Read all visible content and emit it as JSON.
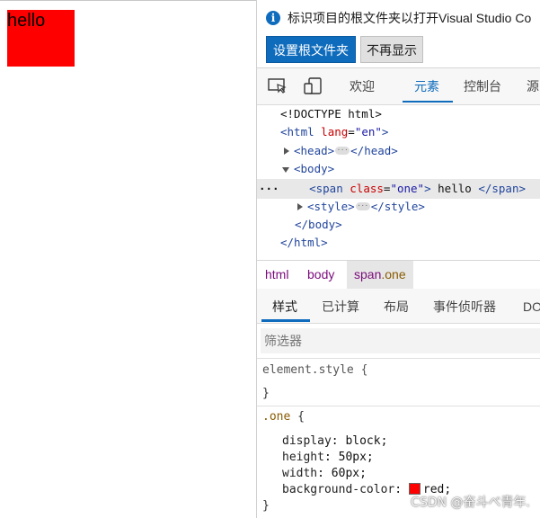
{
  "preview": {
    "hello_text": "hello",
    "box_color": "#ff0000"
  },
  "infobar": {
    "icon": "info-icon",
    "message": "标识项目的根文件夹以打开Visual Studio Co",
    "primary_button": "设置根文件夹",
    "secondary_button": "不再显示",
    "accent": "#0f6cbd"
  },
  "toolbar": {
    "inspect_icon": "inspect-element-icon",
    "device_icon": "device-emulation-icon",
    "tabs": [
      "欢迎",
      "元素",
      "控制台",
      "源"
    ],
    "active_tab": "元素"
  },
  "dom": {
    "doctype": "<!DOCTYPE html>",
    "html_open_tag": "<html",
    "html_attr": "lang",
    "html_attr_value": "\"en\"",
    "html_open_close": ">",
    "head_open": "<head>",
    "head_close": "</head>",
    "body_open": "<body>",
    "row_marker": "···",
    "span_open": "<span",
    "span_attr": "class",
    "span_attr_value": "\"one\"",
    "span_gt": ">",
    "span_text": " hello ",
    "span_close": "</span>",
    "style_open": "<style>",
    "style_close": "</style>",
    "body_close": "</body>",
    "html_close": "</html>",
    "equals": "=",
    "ellipsis": "···"
  },
  "breadcrumb": {
    "items": [
      "html",
      "body"
    ],
    "active_tag": "span",
    "active_class": ".one"
  },
  "subtabs": {
    "items": [
      "样式",
      "已计算",
      "布局",
      "事件侦听器",
      "DO"
    ],
    "active": "样式"
  },
  "filter": {
    "placeholder": "筛选器"
  },
  "styles": {
    "element_style_selector": "element.style {",
    "close_brace": "}",
    "rule_selector": ".one",
    "rule_open": " {",
    "declarations": [
      {
        "prop": "display",
        "value": "block;"
      },
      {
        "prop": "height",
        "value": "50px;"
      },
      {
        "prop": "width",
        "value": "60px;"
      },
      {
        "prop": "background-color",
        "value": "red;"
      }
    ],
    "colon": ": ",
    "swatch_color": "#ff0000"
  },
  "watermark": "CSDN @奋斗べ青年."
}
